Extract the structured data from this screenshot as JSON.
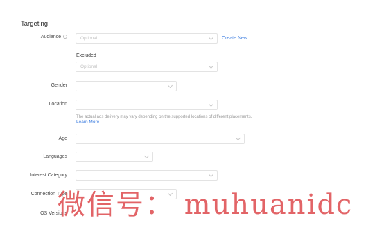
{
  "section": {
    "title": "Targeting"
  },
  "fields": {
    "audience": {
      "label": "Audience",
      "placeholder": "Optional",
      "create_link": "Create New"
    },
    "excluded": {
      "label": "Excluded",
      "placeholder": "Optional"
    },
    "gender": {
      "label": "Gender",
      "value": ""
    },
    "location": {
      "label": "Location",
      "value": "",
      "hint": "The actual ads delivery may vary depending on the supported locations of different placements.",
      "learn_more": "Learn More"
    },
    "age": {
      "label": "Age",
      "value": ""
    },
    "languages": {
      "label": "Languages",
      "value": ""
    },
    "interest_category": {
      "label": "Interest Category",
      "value": ""
    },
    "connection_type": {
      "label": "Connection Type",
      "value": ""
    },
    "os_versions": {
      "label": "OS Versions",
      "value": ""
    }
  },
  "icons": {
    "audience_info": "info-circle-icon",
    "dropdown": "chevron-down-icon"
  },
  "watermark": {
    "text": "微信号： muhuanidc"
  },
  "colors": {
    "link": "#3d7de0",
    "border": "#e3e3e3",
    "placeholder": "#c4c4c4",
    "watermark": "#e0595c"
  }
}
